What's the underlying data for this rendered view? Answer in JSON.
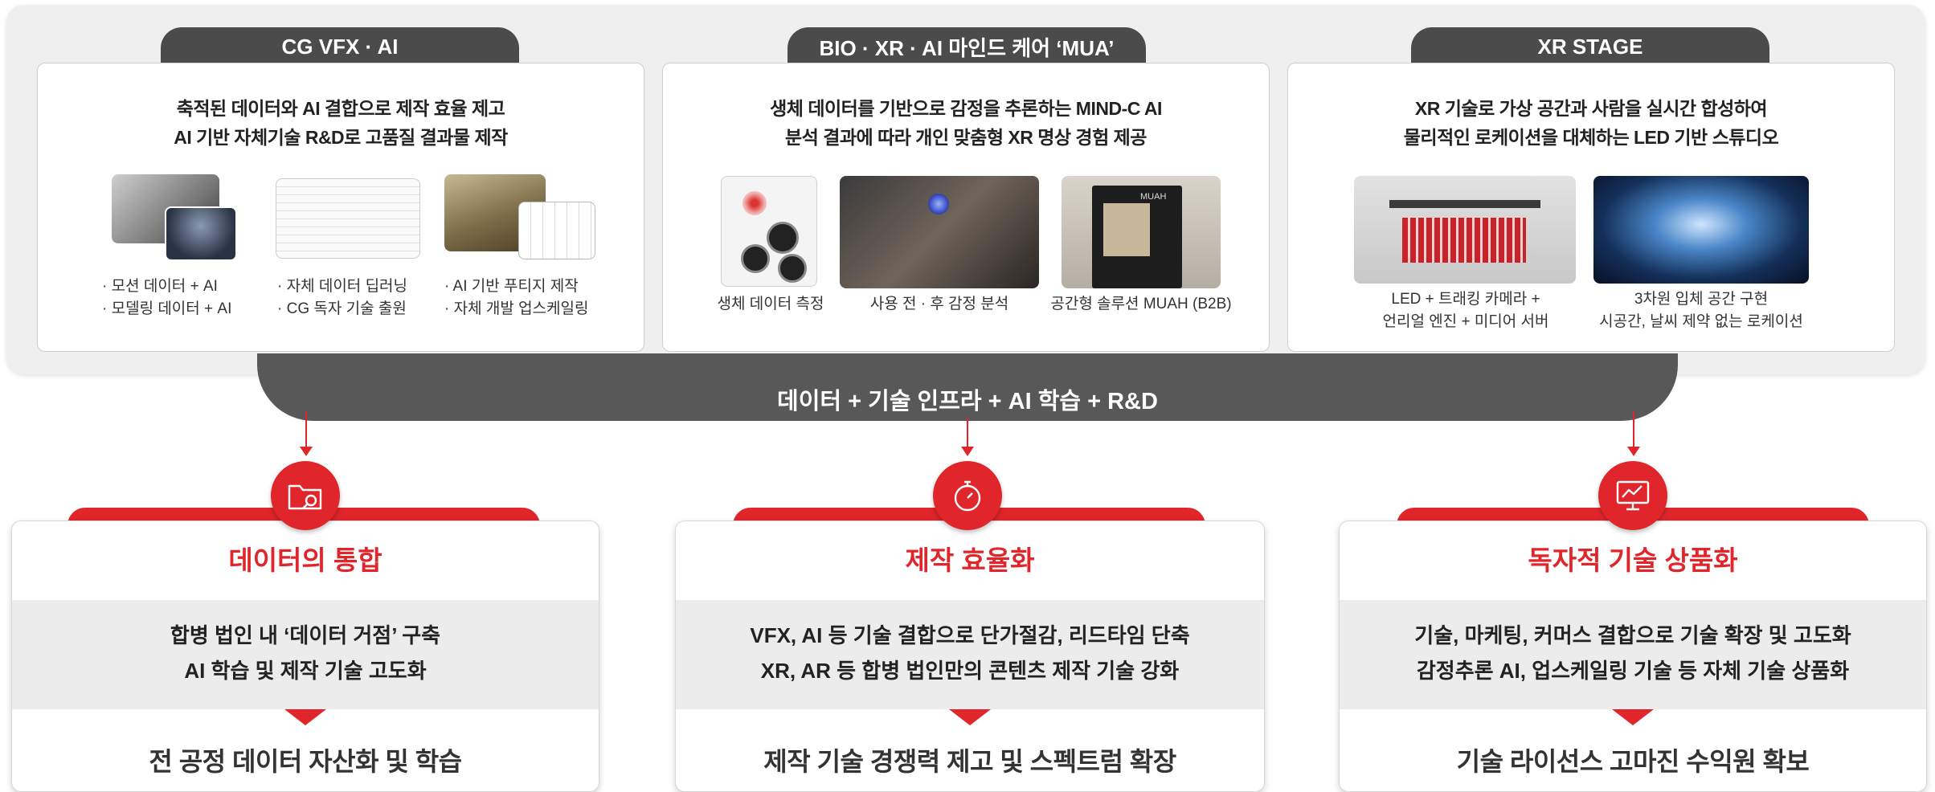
{
  "colors": {
    "accent": "#e0262b",
    "dark_tab": "#4b4b4b",
    "bar": "#585858"
  },
  "top": {
    "sections": [
      {
        "tab": "CG VFX · AI",
        "desc_line1": "축적된 데이터와 AI 결합으로 제작 효율 제고",
        "desc_line2": "AI 기반 자체기술 R&D로 고품질 결과물 제작",
        "items": [
          {
            "line1": "· 모션 데이터 + AI",
            "line2": "· 모델링 데이터 + AI"
          },
          {
            "line1": "· 자체 데이터 딥러닝",
            "line2": "· CG 독자 기술 출원"
          },
          {
            "line1": "· AI 기반 푸티지 제작",
            "line2": "· 자체 개발 업스케일링"
          }
        ]
      },
      {
        "tab": "BIO · XR · AI  마인드 케어 ‘MUA’",
        "desc_line1": "생체 데이터를 기반으로 감정을 추론하는 MIND-C AI",
        "desc_line2": "분석 결과에 따라 개인 맞춤형 XR 명상 경험 제공",
        "items": [
          {
            "line1": "생체 데이터 측정"
          },
          {
            "line1": "사용 전 · 후 감정 분석"
          },
          {
            "line1": "공간형 솔루션 MUAH (B2B)"
          }
        ],
        "muah_sign": "MUAH"
      },
      {
        "tab": "XR STAGE",
        "desc_line1": "XR 기술로 가상 공간과 사람을 실시간 합성하여",
        "desc_line2": "물리적인 로케이션을 대체하는 LED 기반 스튜디오",
        "items": [
          {
            "line1": "LED + 트래킹 카메라 +",
            "line2": "언리얼 엔진 + 미디어 서버"
          },
          {
            "line1": "3차원 입체 공간 구현",
            "line2": "시공간, 날씨 제약 없는 로케이션"
          }
        ]
      }
    ],
    "infra_label": "데이터 + 기술 인프라 + AI 학습 + R&D"
  },
  "bottom": [
    {
      "icon": "folder-search-icon",
      "title": "데이터의 통합",
      "desc_line1": "합병 법인 내 ‘데이터 거점’ 구축",
      "desc_line2": "AI 학습 및 제작 기술 고도화",
      "result": "전 공정 데이터 자산화 및 학습"
    },
    {
      "icon": "stopwatch-icon",
      "title": "제작 효율화",
      "desc_line1": "VFX, AI 등 기술 결합으로 단가절감, 리드타임 단축",
      "desc_line2": "XR, AR 등 합병 법인만의 콘텐츠 제작 기술 강화",
      "result": "제작 기술 경쟁력 제고 및 스펙트럼 확장"
    },
    {
      "icon": "monitor-graph-icon",
      "title": "독자적 기술 상품화",
      "desc_line1": "기술, 마케팅, 커머스 결합으로 기술 확장 및 고도화",
      "desc_line2": "감정추론 AI, 업스케일링 기술 등 자체 기술 상품화",
      "result": "기술 라이선스 고마진 수익원 확보"
    }
  ]
}
